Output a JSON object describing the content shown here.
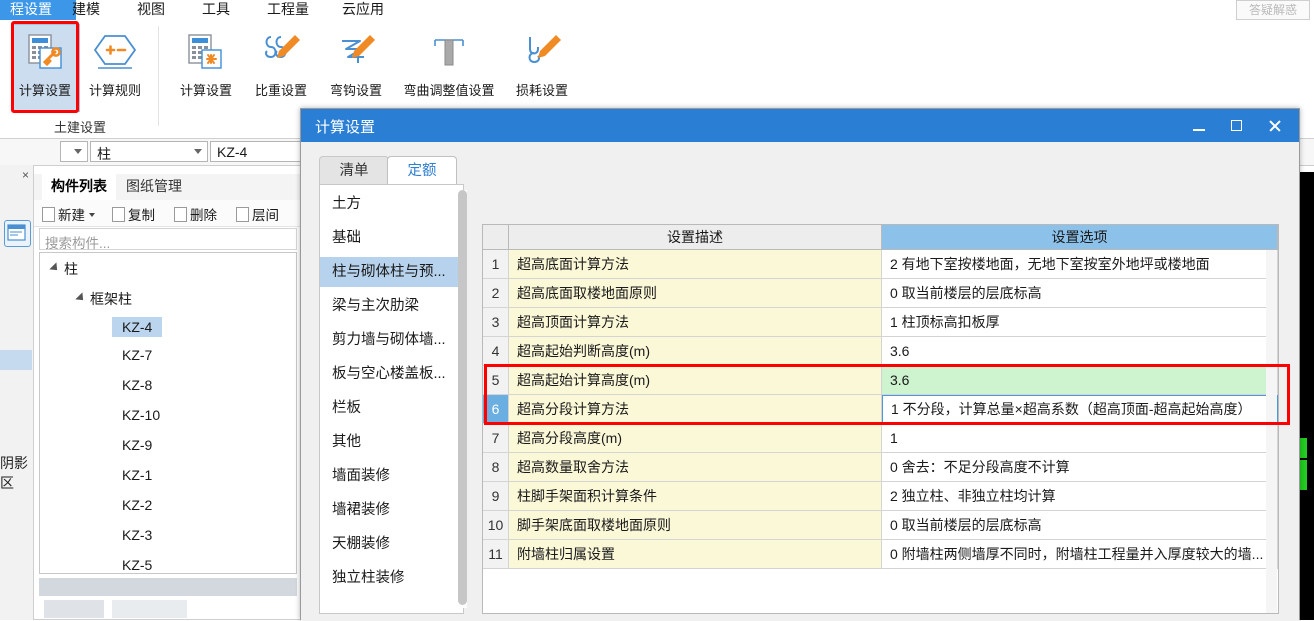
{
  "ribbon": {
    "tabs": [
      {
        "label": "程设置",
        "active": true
      },
      {
        "label": "建模",
        "active": false
      },
      {
        "label": "视图",
        "active": false
      },
      {
        "label": "工具",
        "active": false
      },
      {
        "label": "工程量",
        "active": false
      },
      {
        "label": "云应用",
        "active": false
      }
    ],
    "help_label": "答疑解惑",
    "groups": [
      {
        "name": "土建设置",
        "items": [
          {
            "label": "计算设置",
            "icon": "calculator-wrench-icon",
            "selected": true
          },
          {
            "label": "计算规则",
            "icon": "hexagon-plus-minus-icon",
            "selected": false
          }
        ]
      },
      {
        "name": "",
        "items": [
          {
            "label": "计算设置",
            "icon": "calculator-rebar-icon",
            "selected": false
          },
          {
            "label": "比重设置",
            "icon": "rebar-pencil-icon",
            "selected": false
          },
          {
            "label": "弯钩设置",
            "icon": "hook-pencil-icon",
            "selected": false
          },
          {
            "label": "弯曲调整值设置",
            "icon": "column-bar-icon",
            "selected": false
          },
          {
            "label": "损耗设置",
            "icon": "waste-pencil-icon",
            "selected": false
          }
        ]
      }
    ]
  },
  "toolbar": {
    "combo_category": "柱",
    "combo_component": "KZ-4"
  },
  "left_strip": {
    "close_label": "×",
    "icon": "properties-panel-icon",
    "vertical_text": "阴影区"
  },
  "component_panel": {
    "tabs": [
      {
        "label": "构件列表",
        "active": true
      },
      {
        "label": "图纸管理",
        "active": false
      }
    ],
    "toolbar": [
      {
        "label": "新建",
        "icon": "new-document-icon",
        "has_caret": true
      },
      {
        "label": "复制",
        "icon": "copy-icon",
        "has_caret": false
      },
      {
        "label": "删除",
        "icon": "delete-icon",
        "has_caret": false
      },
      {
        "label": "层间",
        "icon": "layer-icon",
        "has_caret": false
      }
    ],
    "search_placeholder": "搜索构件...",
    "tree": {
      "root": "柱",
      "group": "框架柱",
      "items": [
        "KZ-4",
        "KZ-7",
        "KZ-8",
        "KZ-10",
        "KZ-9",
        "KZ-1",
        "KZ-2",
        "KZ-3",
        "KZ-5"
      ],
      "selected": "KZ-4"
    }
  },
  "dialog": {
    "title": "计算设置",
    "window_buttons": {
      "minimize": "minimize-icon",
      "maximize": "maximize-icon",
      "close": "close-icon"
    },
    "tabs": [
      {
        "label": "清单",
        "active": false
      },
      {
        "label": "定额",
        "active": true
      }
    ],
    "categories": [
      {
        "label": "土方",
        "selected": false
      },
      {
        "label": "基础",
        "selected": false
      },
      {
        "label": "柱与砌体柱与预...",
        "selected": true
      },
      {
        "label": "梁与主次肋梁",
        "selected": false
      },
      {
        "label": "剪力墙与砌体墙...",
        "selected": false
      },
      {
        "label": "板与空心楼盖板...",
        "selected": false
      },
      {
        "label": "栏板",
        "selected": false
      },
      {
        "label": "其他",
        "selected": false
      },
      {
        "label": "墙面装修",
        "selected": false
      },
      {
        "label": "墙裙装修",
        "selected": false
      },
      {
        "label": "天棚装修",
        "selected": false
      },
      {
        "label": "独立柱装修",
        "selected": false
      }
    ],
    "table": {
      "headers": [
        "",
        "设置描述",
        "设置选项"
      ],
      "rows": [
        {
          "n": "1",
          "desc": "超高底面计算方法",
          "value": "2 有地下室按楼地面，无地下室按室外地坪或楼地面",
          "state": "normal"
        },
        {
          "n": "2",
          "desc": "超高底面取楼地面原则",
          "value": "0 取当前楼层的层底标高",
          "state": "normal"
        },
        {
          "n": "3",
          "desc": "超高顶面计算方法",
          "value": "1 柱顶标高扣板厚",
          "state": "normal"
        },
        {
          "n": "4",
          "desc": "超高起始判断高度(m)",
          "value": "3.6",
          "state": "normal"
        },
        {
          "n": "5",
          "desc": "超高起始计算高度(m)",
          "value": "3.6",
          "state": "green"
        },
        {
          "n": "6",
          "desc": "超高分段计算方法",
          "value": "1 不分段，计算总量×超高系数（超高顶面-超高起始高度）",
          "state": "editing"
        },
        {
          "n": "7",
          "desc": "超高分段高度(m)",
          "value": "1",
          "state": "normal"
        },
        {
          "n": "8",
          "desc": "超高数量取舍方法",
          "value": "0 舍去：不足分段高度不计算",
          "state": "normal"
        },
        {
          "n": "9",
          "desc": "柱脚手架面积计算条件",
          "value": "2 独立柱、非独立柱均计算",
          "state": "normal"
        },
        {
          "n": "10",
          "desc": "脚手架底面取楼地面原则",
          "value": "0 取当前楼层的层底标高",
          "state": "normal"
        },
        {
          "n": "11",
          "desc": "附墙柱归属设置",
          "value": "0 附墙柱两侧墙厚不同时，附墙柱工程量并入厚度较大的墙...",
          "state": "normal"
        }
      ]
    }
  },
  "colors": {
    "accent_blue": "#2a7fd4",
    "header_blue": "#8cc1ea",
    "row_yellow": "#fbf8d8",
    "row_green": "#cdf3cf",
    "selection_blue": "#b7d2ec",
    "annotation_red": "#fe0000"
  }
}
